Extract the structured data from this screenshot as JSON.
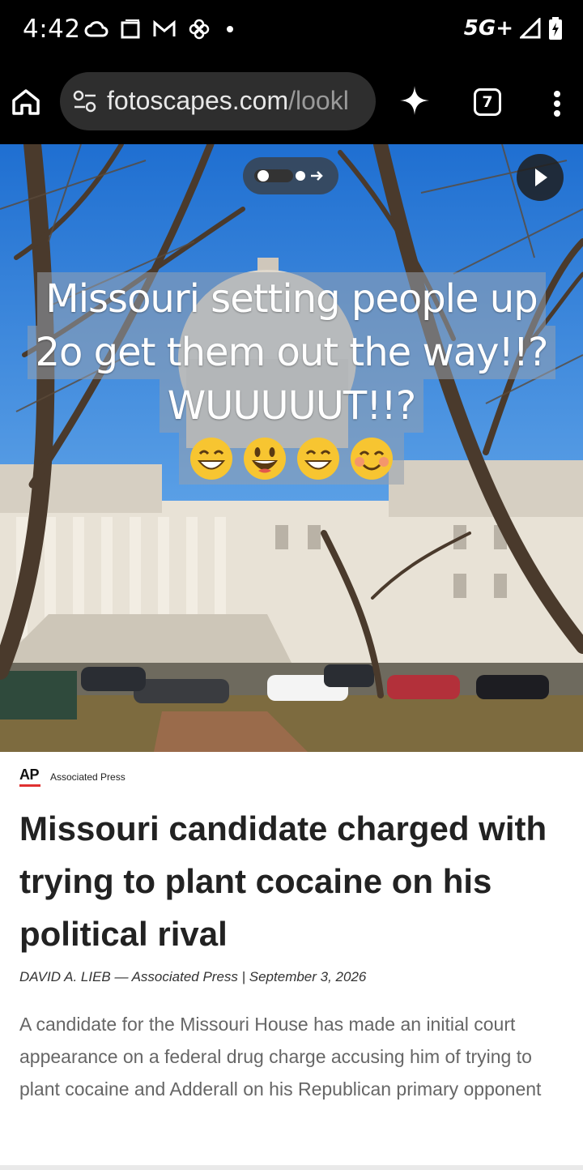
{
  "status_bar": {
    "time": "4:42",
    "network": "5G+",
    "icons": [
      "cloud-icon",
      "screen-icon",
      "gmail-icon",
      "pinwheel-icon",
      "dot-icon",
      "signal-icon",
      "battery-charging-icon"
    ]
  },
  "browser": {
    "url_domain": "fotoscapes.com",
    "url_path": "/lookl",
    "tab_count": "7"
  },
  "hero": {
    "caption_lines": [
      "Missouri setting people up",
      "2o get them out the way!!?",
      "WUUUUUT!!?"
    ],
    "emojis": [
      "grinning-face-with-smiling-eyes",
      "grinning-face",
      "grinning-face-with-smiling-eyes",
      "smiling-face-with-smiling-eyes"
    ]
  },
  "article": {
    "publisher_logo": "AP",
    "publisher_name": "Associated Press",
    "headline": "Missouri candidate charged with trying to plant cocaine on his political rival",
    "byline": "DAVID A. LIEB — Associated Press | September 3, 2026",
    "summary": "A candidate for the Missouri House has made an initial court appearance on a federal drug charge accusing him of trying to plant cocaine and Adderall on his Republican primary opponent"
  },
  "colors": {
    "status_bar_bg": "#000000",
    "url_bar_bg": "#2e2e2e",
    "ap_red": "#e03030",
    "headline_text": "#222222",
    "summary_text": "#666666"
  }
}
